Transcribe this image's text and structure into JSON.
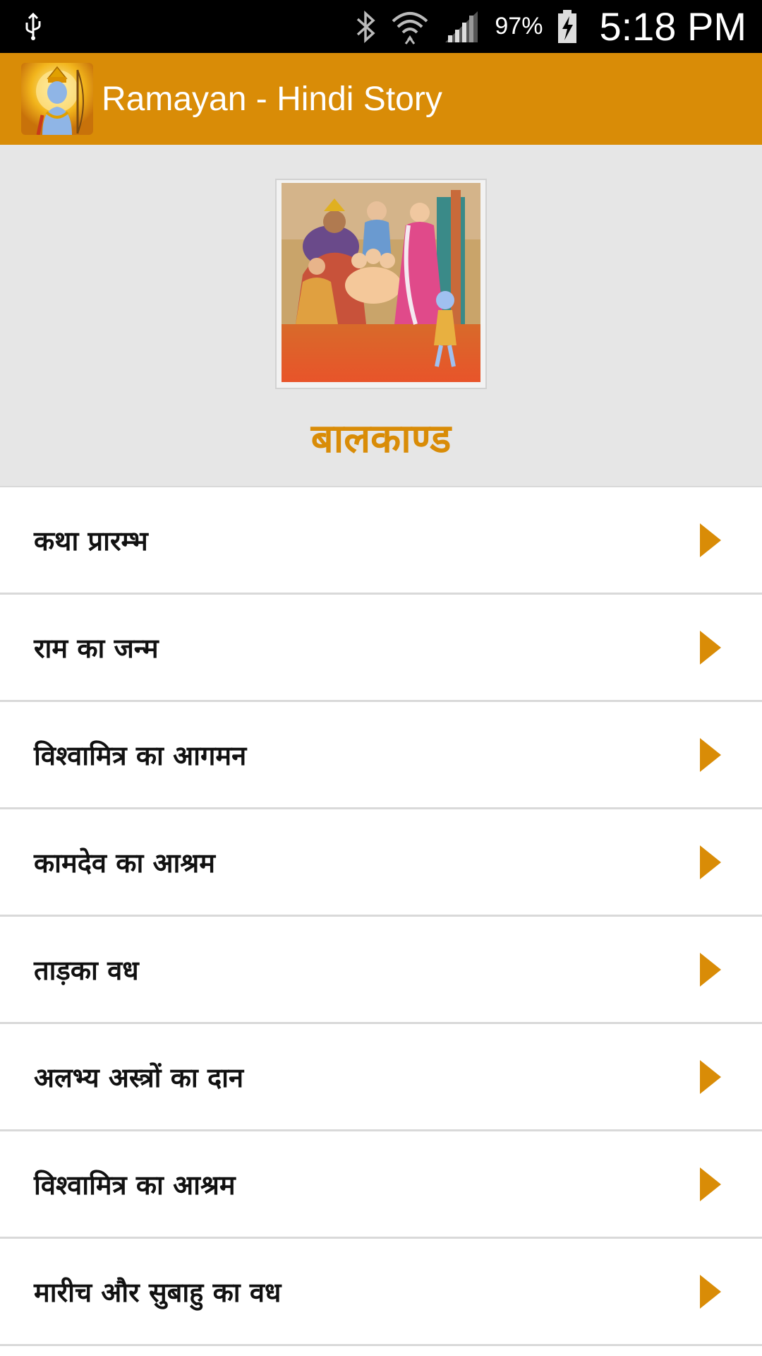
{
  "status_bar": {
    "battery_percent": "97%",
    "time": "5:18 PM",
    "icons": [
      "usb-icon",
      "bluetooth-icon",
      "wifi-icon",
      "signal-icon",
      "battery-charging-icon"
    ]
  },
  "app_bar": {
    "title": "Ramayan - Hindi Story",
    "logo_icon": "rama-avatar-icon"
  },
  "hero": {
    "title": "बालकाण्ड",
    "image_icon": "balkand-painting-image"
  },
  "chapters": [
    {
      "label": "कथा प्रारम्भ"
    },
    {
      "label": "राम का जन्म"
    },
    {
      "label": "विश्वामित्र का आगमन"
    },
    {
      "label": "कामदेव का आश्रम"
    },
    {
      "label": "ताड़का वध"
    },
    {
      "label": "अलभ्य अस्त्रों का दान"
    },
    {
      "label": "विश्वामित्र का आश्रम"
    },
    {
      "label": "मारीच और सुबाहु का वध"
    }
  ],
  "colors": {
    "accent": "#d98c07",
    "status_bar": "#000000",
    "hero_bg": "#e6e6e6",
    "divider": "#d9d9d9"
  }
}
